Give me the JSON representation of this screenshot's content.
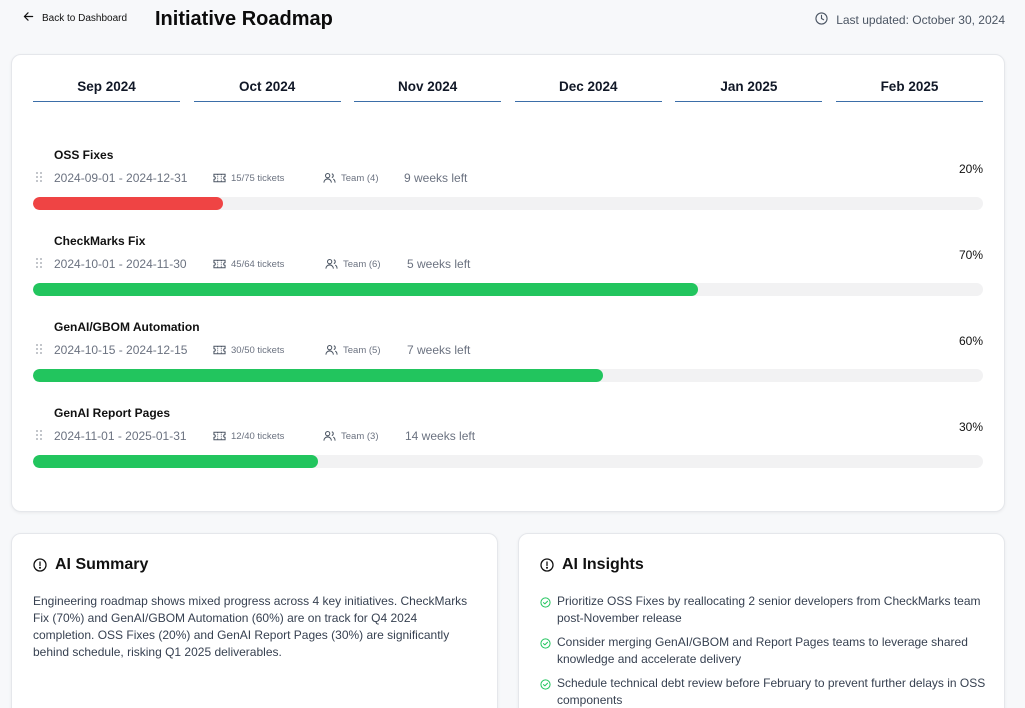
{
  "header": {
    "back_label": "Back to Dashboard",
    "title": "Initiative Roadmap",
    "updated_label": "Last updated: October 30, 2024"
  },
  "months": [
    "Sep 2024",
    "Oct 2024",
    "Nov 2024",
    "Dec 2024",
    "Jan 2025",
    "Feb 2025"
  ],
  "initiatives": [
    {
      "name": "OSS Fixes",
      "dates": "2024-09-01 - 2024-12-31",
      "tickets": "15/75 tickets",
      "team": "Team (4)",
      "remaining": "9 weeks left",
      "percent_label": "20%",
      "progress": 0.2,
      "color": "#ef4444"
    },
    {
      "name": "CheckMarks Fix",
      "dates": "2024-10-01 - 2024-11-30",
      "tickets": "45/64 tickets",
      "team": "Team (6)",
      "remaining": "5 weeks left",
      "percent_label": "70%",
      "progress": 0.7,
      "color": "#22c55e"
    },
    {
      "name": "GenAI/GBOM Automation",
      "dates": "2024-10-15 - 2024-12-15",
      "tickets": "30/50 tickets",
      "team": "Team (5)",
      "remaining": "7 weeks left",
      "percent_label": "60%",
      "progress": 0.6,
      "color": "#22c55e"
    },
    {
      "name": "GenAI Report Pages",
      "dates": "2024-11-01 - 2025-01-31",
      "tickets": "12/40 tickets",
      "team": "Team (3)",
      "remaining": "14 weeks left",
      "percent_label": "30%",
      "progress": 0.3,
      "color": "#22c55e"
    }
  ],
  "summary": {
    "title": "AI Summary",
    "text": "Engineering roadmap shows mixed progress across 4 key initiatives. CheckMarks Fix (70%) and GenAI/GBOM Automation (60%) are on track for Q4 2024 completion. OSS Fixes (20%) and GenAI Report Pages (30%) are significantly behind schedule, risking Q1 2025 deliverables."
  },
  "insights": {
    "title": "AI Insights",
    "items": [
      "Prioritize OSS Fixes by reallocating 2 senior developers from CheckMarks team post-November release",
      "Consider merging GenAI/GBOM and Report Pages teams to leverage shared knowledge and accelerate delivery",
      "Schedule technical debt review before February to prevent further delays in OSS components"
    ]
  },
  "colors": {
    "accent": "#3b6ea8",
    "danger": "#ef4444",
    "success": "#22c55e",
    "track": "#f2f2f3"
  },
  "icons": {
    "back": "arrow-left-icon",
    "clock": "clock-icon",
    "grip": "grip-vertical-icon",
    "ticket": "ticket-icon",
    "team": "users-icon",
    "info": "alert-circle-icon",
    "check": "check-circle-icon"
  }
}
